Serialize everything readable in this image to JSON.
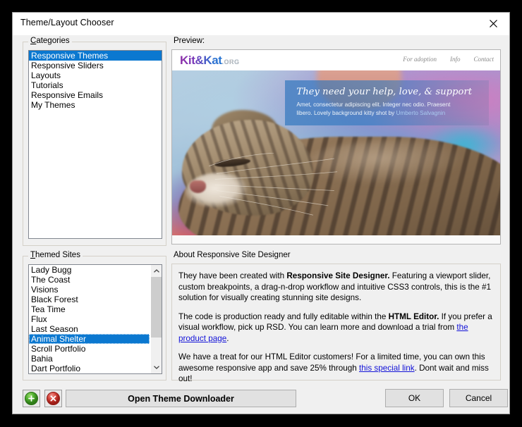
{
  "window": {
    "title": "Theme/Layout Chooser",
    "close_icon": "close-icon"
  },
  "categories": {
    "label": "Categories",
    "accel": "C",
    "items": [
      {
        "label": "Responsive Themes",
        "selected": true
      },
      {
        "label": "Responsive Sliders",
        "selected": false
      },
      {
        "label": "Layouts",
        "selected": false
      },
      {
        "label": "Tutorials",
        "selected": false
      },
      {
        "label": "Responsive Emails",
        "selected": false
      },
      {
        "label": "My Themes",
        "selected": false
      }
    ]
  },
  "themed_sites": {
    "label": "Themed Sites",
    "accel": "T",
    "items": [
      {
        "label": "Lady Bugg",
        "selected": false
      },
      {
        "label": "The Coast",
        "selected": false
      },
      {
        "label": "Visions",
        "selected": false
      },
      {
        "label": "Black Forest",
        "selected": false
      },
      {
        "label": "Tea Time",
        "selected": false
      },
      {
        "label": "Flux",
        "selected": false
      },
      {
        "label": "Last Season",
        "selected": false
      },
      {
        "label": "Animal Shelter",
        "selected": true
      },
      {
        "label": "Scroll Portfolio",
        "selected": false
      },
      {
        "label": "Bahia",
        "selected": false
      },
      {
        "label": "Dart Portfolio",
        "selected": false
      }
    ],
    "scrollbar": {
      "up_icon": "chevron-up-icon",
      "down_icon": "chevron-down-icon"
    }
  },
  "preview": {
    "label": "Preview:",
    "site": {
      "logo_main": "Kit&Kat",
      "logo_tld": ".ORG",
      "nav": [
        "For adoption",
        "Info",
        "Contact"
      ],
      "hero_headline": "They need your help, love, & support",
      "hero_sub_1": "Amet, consectetur adipiscing elit. Integer nec odio. Praesent",
      "hero_sub_2": "libero. Lovely background kitty shot by ",
      "hero_author": "Umberto Salvagnin"
    }
  },
  "about": {
    "label": "About Responsive Site Designer",
    "p1_a": "They have been created with ",
    "p1_b": "Responsive Site Designer.",
    "p1_c": " Featuring a viewport slider, custom breakpoints, a drag-n-drop workflow and intuitive CSS3 controls, this is the #1 solution for visually creating stunning site designs.",
    "p2_a": "The code is production ready and fully editable within the ",
    "p2_b": "HTML Editor.",
    "p2_c": " If you prefer a visual workflow, pick up RSD. You can learn more and download a trial from ",
    "p2_link": "the product page",
    "p2_d": ".",
    "p3_a": "We have a treat for our HTML Editor customers! For a limited time, you can own this awesome responsive app and save 25% through ",
    "p3_link": "this special link",
    "p3_b": ". Dont wait and miss out!"
  },
  "footer": {
    "add_icon": "plus-circle-icon",
    "delete_icon": "delete-circle-icon",
    "downloader_label": "Open Theme Downloader",
    "ok_label": "OK",
    "cancel_label": "Cancel"
  },
  "colors": {
    "selection": "#0b78d0",
    "link": "#1212d8",
    "window_bg": "#f0f0f0",
    "desktop_bg": "#000000"
  }
}
